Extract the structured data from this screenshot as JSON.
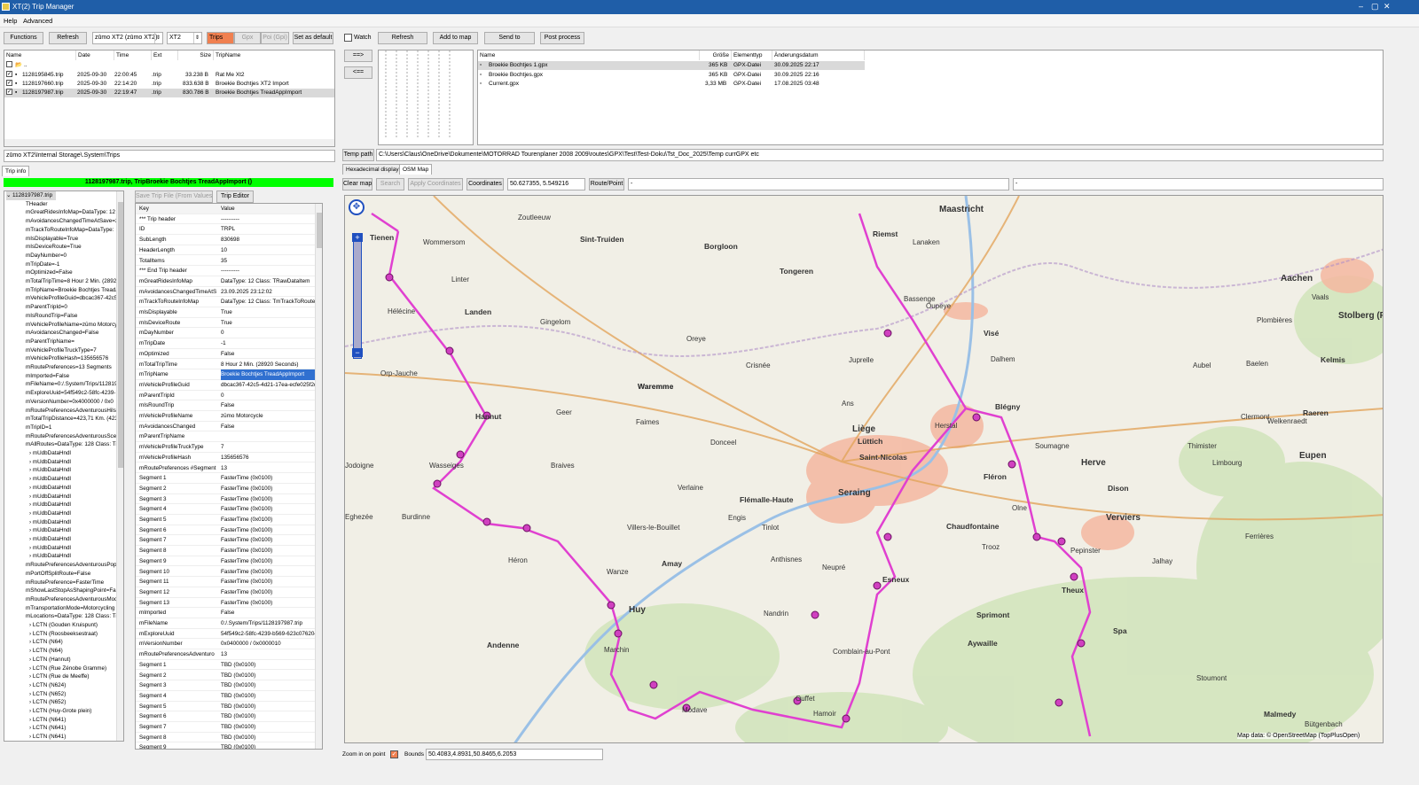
{
  "window": {
    "title": "XT(2) Trip Manager",
    "min": "–",
    "max": "▢",
    "close": "✕"
  },
  "menu": {
    "help": "Help",
    "advanced": "Advanced"
  },
  "toolbar_left": {
    "functions": "Functions",
    "refresh": "Refresh",
    "device": "zūmo XT2 (zūmo XT2)",
    "model": "XT2",
    "trips": "Trips",
    "gpx": "Gpx",
    "poi": "Poi (Gpi)",
    "set_default": "Set as default"
  },
  "toolbar_right": {
    "watch": "Watch",
    "refresh": "Refresh",
    "add_to_map": "Add to map",
    "send_to": "Send to",
    "post_process": "Post process"
  },
  "arrows": {
    "right": "==>",
    "left": "<=="
  },
  "trips_table": {
    "headers": [
      "Name",
      "Date",
      "Time",
      "Ext",
      "Size",
      "TripName"
    ],
    "rows": [
      {
        "name": "..",
        "date": "",
        "time": "",
        "ext": "",
        "size": "",
        "trip": ""
      },
      {
        "name": "1128195845.trip",
        "date": "2025-09-30",
        "time": "22:00:45",
        "ext": ".trip",
        "size": "33.238 B",
        "trip": "Rat Me Xt2"
      },
      {
        "name": "1128197660.trip",
        "date": "2025-09-30",
        "time": "22:14:20",
        "ext": ".trip",
        "size": "833.638 B",
        "trip": "Broekie Bochtjes XT2 Import"
      },
      {
        "name": "1128197987.trip",
        "date": "2025-09-30",
        "time": "22:19:47",
        "ext": ".trip",
        "size": "830.786 B",
        "trip": "Broekie Bochtjes TreadAppImport"
      }
    ],
    "path": "zūmo XT2\\Internal Storage\\.System\\Trips"
  },
  "files_table": {
    "headers": [
      "Name",
      "Größe",
      "Elementtyp",
      "Änderungsdatum"
    ],
    "rows": [
      {
        "name": "Broekie Bochtjes 1.gpx",
        "size": "365 KB",
        "type": "GPX-Datei",
        "date": "30.09.2025 22:17"
      },
      {
        "name": "Broekie Bochtjes.gpx",
        "size": "365 KB",
        "type": "GPX-Datei",
        "date": "30.09.2025 22:16"
      },
      {
        "name": "Current.gpx",
        "size": "3,33 MB",
        "type": "GPX-Datei",
        "date": "17.08.2025 03:48"
      }
    ]
  },
  "temp_path": {
    "label": "Temp path",
    "value": "C:\\Users\\Claus\\OneDrive\\Dokumente\\MOTORRAD Tourenplaner 2008 2009\\routes\\GPX\\Test\\Test-Doku\\Tst_Doc_2025\\Temp currGPX etc"
  },
  "tabs_left": {
    "trip_info": "Trip info"
  },
  "tabs_right": {
    "hex": "Hexadecimal display",
    "osm": "OSM Map"
  },
  "trip_header": "1128197987.trip, TripBroekie Bochtjes TreadAppImport ()",
  "trip_buttons": {
    "save": "Save Trip File (From Values)",
    "editor": "Trip Editor"
  },
  "tree": {
    "root": "1128197987.trip",
    "items": [
      "THeader",
      "mGreatRidesInfoMap=DataType: 12",
      "mAvoidancesChangedTimeAtSave=2",
      "mTrackToRouteInfoMap=DataType:",
      "mIsDisplayable=True",
      "mIsDeviceRoute=True",
      "mDayNumber=0",
      "mTripDate=-1",
      "mOptimized=False",
      "mTotalTripTime=8 Hour 2 Min. (2892(",
      "mTripName=Broekie Bochtjes TreadA",
      "mVehicleProfileGuid=dbcac367-42c5-",
      "mParentTripId=0",
      "mIsRoundTrip=False",
      "mVehicleProfileName=zūmo Motorcyc",
      "mAvoidancesChanged=False",
      "mParentTripName=",
      "mVehicleProfileTruckType=7",
      "mVehicleProfileHash=135656576",
      "mRoutePreferences=13 Segments",
      "mImported=False",
      "mFileName=0:/.System/Trips/1128197",
      "mExploreUuid=54f549c2-58fc-4239-",
      "mVersionNumber=0x4000000 / 0x0",
      "mRoutePreferencesAdventurousHilsu",
      "mTotalTripDistance=423,71 Km. (423.",
      "mTripID=1",
      "mRoutePreferencesAdventurousScen",
      "mAllRoutes=DataType: 128 Class: Tr"
    ],
    "udb": [
      "mUdbDataHndl",
      "mUdbDataHndl",
      "mUdbDataHndl",
      "mUdbDataHndl",
      "mUdbDataHndl",
      "mUdbDataHndl",
      "mUdbDataHndl",
      "mUdbDataHndl",
      "mUdbDataHndl",
      "mUdbDataHndl",
      "mUdbDataHndl",
      "mUdbDataHndl",
      "mUdbDataHndl"
    ],
    "items2": [
      "mRoutePreferencesAdventurousPopu",
      "mPortOffSplitRoute=False",
      "mRoutePreference=FasterTime",
      "mShowLastStopAsShapingPoint=Fals",
      "mRoutePreferencesAdventurousMod",
      "mTransportationMode=Motorcycling",
      "mLocations=DataType: 128 Class: Tr"
    ],
    "locations": [
      "LCTN (Gouden Kruispunt)",
      "LCTN (Roosbeeksestraat)",
      "LCTN (N64)",
      "LCTN (N64)",
      "LCTN (Hannut)",
      "LCTN (Rue Zénobe Gramme)",
      "LCTN (Rue de Meeffe)",
      "LCTN (N624)",
      "LCTN (N652)",
      "LCTN (N652)",
      "LCTN (Huy-Grote plein)",
      "LCTN (N641)",
      "LCTN (N641)",
      "LCTN (N641)"
    ]
  },
  "kv_table": {
    "headers": [
      "Key",
      "Value"
    ],
    "rows": [
      [
        "*** Trip header",
        "----------"
      ],
      [
        "ID",
        "TRPL"
      ],
      [
        "SubLength",
        "830698"
      ],
      [
        "HeaderLength",
        "10"
      ],
      [
        "TotalItems",
        "35"
      ],
      [
        "*** End Trip header",
        "----------"
      ],
      [
        "mGreatRidesInfoMap",
        "DataType: 12 Class: TRawDataItem"
      ],
      [
        "mAvoidancesChangedTimeAtS",
        "23.09.2025 23:12:02"
      ],
      [
        "mTrackToRouteInfoMap",
        "DataType: 12 Class: TmTrackToRouteInfo"
      ],
      [
        "mIsDisplayable",
        "True"
      ],
      [
        "mIsDeviceRoute",
        "True"
      ],
      [
        "mDayNumber",
        "0"
      ],
      [
        "mTripDate",
        "-1"
      ],
      [
        "mOptimized",
        "False"
      ],
      [
        "mTotalTripTime",
        "8 Hour 2 Min. (28920 Seconds)"
      ],
      [
        "mTripName",
        "Broekie Bochtjes TreadAppImport"
      ],
      [
        "mVehicleProfileGuid",
        "dbcac367-42c5-4d21-17ea-ecfe025f2d"
      ],
      [
        "mParentTripId",
        "0"
      ],
      [
        "mIsRoundTrip",
        "False"
      ],
      [
        "mVehicleProfileName",
        "zūmo Motorcycle"
      ],
      [
        "mAvoidancesChanged",
        "False"
      ],
      [
        "mParentTripName",
        ""
      ],
      [
        "mVehicleProfileTruckType",
        "7"
      ],
      [
        "mVehicleProfileHash",
        "135656576"
      ],
      [
        "mRoutePreferences #Segment",
        "13"
      ],
      [
        "Segment 1",
        "FasterTime (0x0100)"
      ],
      [
        "Segment 2",
        "FasterTime (0x0100)"
      ],
      [
        "Segment 3",
        "FasterTime (0x0100)"
      ],
      [
        "Segment 4",
        "FasterTime (0x0100)"
      ],
      [
        "Segment 5",
        "FasterTime (0x0100)"
      ],
      [
        "Segment 6",
        "FasterTime (0x0100)"
      ],
      [
        "Segment 7",
        "FasterTime (0x0100)"
      ],
      [
        "Segment 8",
        "FasterTime (0x0100)"
      ],
      [
        "Segment 9",
        "FasterTime (0x0100)"
      ],
      [
        "Segment 10",
        "FasterTime (0x0100)"
      ],
      [
        "Segment 11",
        "FasterTime (0x0100)"
      ],
      [
        "Segment 12",
        "FasterTime (0x0100)"
      ],
      [
        "Segment 13",
        "FasterTime (0x0100)"
      ],
      [
        "mImported",
        "False"
      ],
      [
        "mFileName",
        "0:/.System/Trips/1128197987.trip"
      ],
      [
        "mExploreUuid",
        "54f549c2-58fc-4239-b569-623c076204"
      ],
      [
        "mVersionNumber",
        "0x0400000 / 0x0000010"
      ],
      [
        "mRoutePreferencesAdventuro",
        "13"
      ],
      [
        "Segment 1",
        "TBD (0x0100)"
      ],
      [
        "Segment 2",
        "TBD (0x0100)"
      ],
      [
        "Segment 3",
        "TBD (0x0100)"
      ],
      [
        "Segment 4",
        "TBD (0x0100)"
      ],
      [
        "Segment 5",
        "TBD (0x0100)"
      ],
      [
        "Segment 6",
        "TBD (0x0100)"
      ],
      [
        "Segment 7",
        "TBD (0x0100)"
      ],
      [
        "Segment 8",
        "TBD (0x0100)"
      ],
      [
        "Segment 9",
        "TBD (0x0100)"
      ]
    ]
  },
  "map_toolbar": {
    "clear": "Clear map",
    "search": "Search",
    "apply": "Apply Coordinates",
    "coords_label": "Coordinates",
    "coords": "50.627355, 5.549216",
    "route_point": "Route/Point",
    "field1": "-",
    "field2": "-"
  },
  "map_labels": [
    "Tienen",
    "Sint-Truiden",
    "Borgloon",
    "Tongeren",
    "Riemst",
    "Maastricht",
    "Aachen",
    "Landen",
    "Waremme",
    "Liège",
    "Lüttich",
    "Saint-Nicolas",
    "Seraing",
    "Flémalle-Haute",
    "Herve",
    "Eupen",
    "Verviers",
    "Dison",
    "Huy",
    "Amay",
    "Hannut",
    "Esneux",
    "Aywaille",
    "Spa",
    "Theux",
    "Malmedy",
    "Chaudfontaine",
    "Fléron",
    "Blégny",
    "Visé",
    "Kelmis",
    "Raeren",
    "Stolberg (Rheinland)",
    "Andenne",
    "Sprimont",
    "Ans",
    "Wanze",
    "Waremme",
    "Gingelom",
    "Wommersom",
    "Zoutleeuw",
    "Oreye",
    "Crisnée",
    "Juprelle",
    "Oupeye",
    "Bassenge",
    "Lanaken",
    "Vaals",
    "Welkenraedt",
    "Limbourg",
    "Pepinster",
    "Jalhay",
    "Stoumont",
    "Ferrières",
    "Comblain-au-Pont",
    "Hamoir",
    "Nandrin",
    "Tinlot",
    "Modave",
    "Marchin",
    "Héron",
    "Braives",
    "Wasseiges",
    "Burdinne",
    "Eghezée",
    "Jodoigne",
    "Orp-Jauche",
    "Hélécine",
    "Linter",
    "Geer",
    "Faimes",
    "Donceel",
    "Verlaine",
    "Villers-le-Bouillet",
    "Engis",
    "Neupré",
    "Ouffet",
    "Anthisnes",
    "Trooz",
    "Olne",
    "Soumagne",
    "Herstal",
    "Dalhem",
    "Baelen",
    "Plombières",
    "Aubel",
    "Thimister",
    "Clermont",
    "Bütgenbach"
  ],
  "map_attrib": "Map data: © OpenStreetMap (TopPlusOpen)",
  "statusbar": {
    "zoom_label": "Zoom in on point",
    "bounds_label": "Bounds",
    "bounds": "50.4083,4.8931,50.8465,6.2053"
  },
  "colors": {
    "route": "#e040d0",
    "header_green": "#00ff00",
    "titlebar": "#1f5ea8",
    "trips_orange": "#f08050"
  }
}
